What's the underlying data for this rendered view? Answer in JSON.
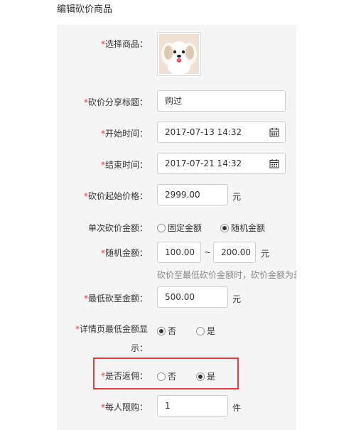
{
  "page": {
    "title": "编辑砍价商品"
  },
  "form": {
    "product": {
      "label": "选择商品：",
      "required_mark": "*"
    },
    "share_title": {
      "label": "砍价分享标题：",
      "required_mark": "*",
      "value": "购过"
    },
    "start_time": {
      "label": "开始时间：",
      "required_mark": "*",
      "value": "2017-07-13 14:32"
    },
    "end_time": {
      "label": "结束时间：",
      "required_mark": "*",
      "value": "2017-07-21 14:32"
    },
    "start_price": {
      "label": "砍价起始价格：",
      "required_mark": "*",
      "value": "2999.00",
      "unit": "元"
    },
    "single_amount": {
      "label": "单次砍价金额：",
      "options": [
        {
          "label": "固定金额",
          "checked": false
        },
        {
          "label": "随机金额",
          "checked": true
        }
      ]
    },
    "random_amount": {
      "label": "随机金额：",
      "required_mark": "*",
      "min_value": "100.00",
      "separator": "~",
      "max_value": "200.00",
      "unit": "元",
      "hint": "砍价至最低砍价金额时，砍价金额为差"
    },
    "min_price": {
      "label": "最低砍至金额：",
      "required_mark": "*",
      "value": "500.00",
      "unit": "元"
    },
    "show_min_on_detail": {
      "label": "详情页最低金额显示：",
      "required_mark": "*",
      "options": [
        {
          "label": "否",
          "checked": true
        },
        {
          "label": "是",
          "checked": false
        }
      ]
    },
    "rebate": {
      "label": "是否返佣：",
      "required_mark": "*",
      "options": [
        {
          "label": "否",
          "checked": false
        },
        {
          "label": "是",
          "checked": true
        }
      ]
    },
    "limit_per_person": {
      "label": "每人限购：",
      "required_mark": "*",
      "value": "1",
      "unit": "件"
    }
  },
  "colors": {
    "required": "#e4393c",
    "highlight_border": "#e43d3d",
    "panel_bg": "#f5f5f5"
  },
  "icons": {
    "calendar": "calendar-icon"
  }
}
